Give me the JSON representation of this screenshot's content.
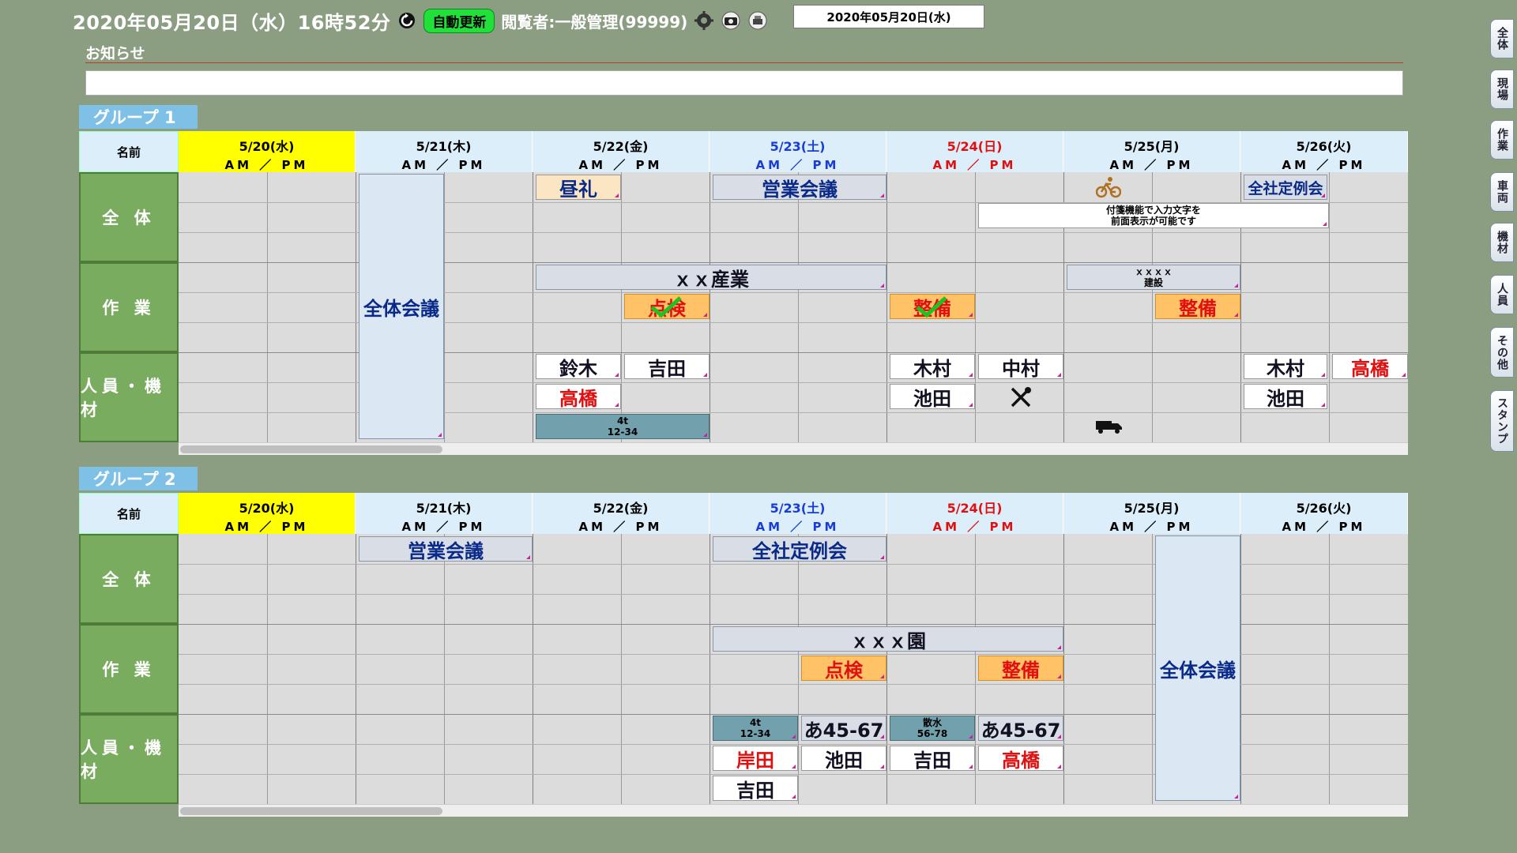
{
  "header": {
    "datetime": "2020年05月20日（水）16時52分",
    "auto_update": "自動更新",
    "viewer": "閲覧者:一般管理(99999)",
    "date_box": "2020年05月20日(水)",
    "notice_label": "お知らせ"
  },
  "right_tabs": [
    "全体",
    "現場",
    "作業",
    "車両",
    "機材",
    "人員",
    "その他",
    "スタンプ"
  ],
  "name_header": "名前",
  "ampm": "AM ／ PM",
  "days": [
    "5/20(水)",
    "5/21(木)",
    "5/22(金)",
    "5/23(土)",
    "5/24(日)",
    "5/25(月)",
    "5/26(火)"
  ],
  "categories": [
    "全 体",
    "作 業",
    "人員・機材"
  ],
  "group1": {
    "label": "グループ 1",
    "events": {
      "zentai_kaigi": "全体会議",
      "chourei": "昼礼",
      "eigyou": "営業会議",
      "teirei": "全社定例会",
      "note": "付箋機能で入力文字を\n前面表示が可能です",
      "sangyo": "ｘｘ産業",
      "kensetsu": "ｘｘｘｘ\n建設",
      "tenken": "点検",
      "seibi1": "整備",
      "seibi2": "整備",
      "suzuki": "鈴木",
      "yoshida": "吉田",
      "takahashi1": "高橋",
      "truck": "4t\n12-34",
      "kimura1": "木村",
      "nakamura": "中村",
      "ikeda1": "池田",
      "kimura2": "木村",
      "takahashi2": "高橋",
      "ikeda2": "池田"
    }
  },
  "group2": {
    "label": "グループ 2",
    "events": {
      "eigyou": "営業会議",
      "teirei": "全社定例会",
      "en": "ｘｘｘ園",
      "tenken": "点検",
      "seibi": "整備",
      "zentai_kaigi": "全体会議",
      "truck1": "4t\n12-34",
      "plate1": "あ45-67",
      "truck2": "散水\n56-78",
      "plate2": "あ45-67",
      "kishida": "岸田",
      "ikeda": "池田",
      "yoshida1": "吉田",
      "takahashi": "高橋",
      "yoshida2": "吉田"
    }
  },
  "colors": {
    "background": "#8c9e82",
    "category": "#7aac5f",
    "today": "#ffff00",
    "header": "#dbeef9",
    "accent_red": "#e01010",
    "saturday": "#1a3cd6"
  }
}
